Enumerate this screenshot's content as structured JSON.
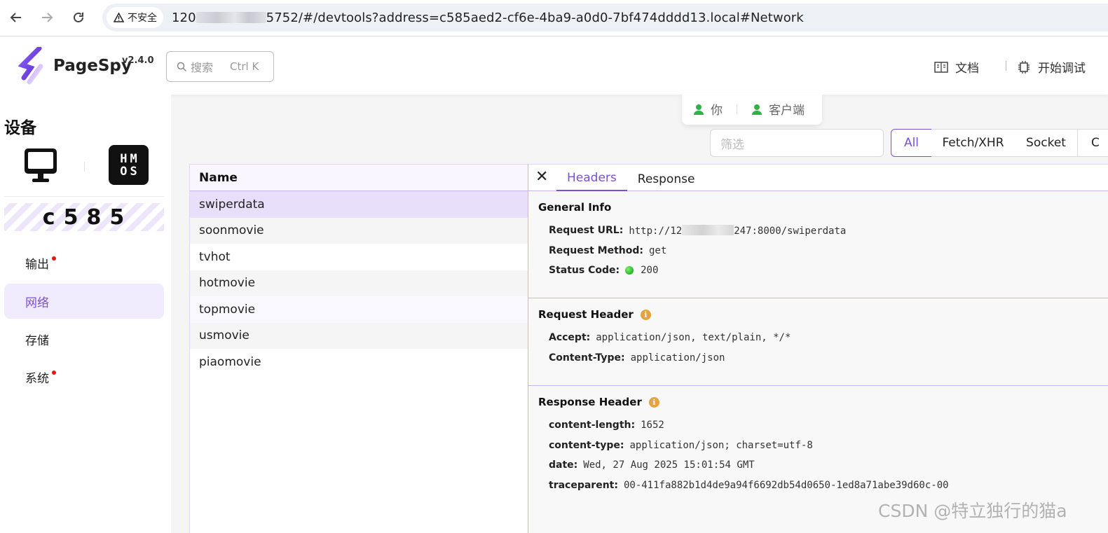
{
  "browser": {
    "security_label": "不安全",
    "url_prefix": "120",
    "url_suffix": "5752/#/devtools?address=c585aed2-cf6e-4ba9-a0d0-7bf474dddd13.local#Network"
  },
  "header": {
    "brand": "PageSpy",
    "version": "v2.4.0",
    "search_placeholder": "搜索",
    "search_shortcut": "Ctrl K",
    "docs_label": "文档",
    "start_debug_label": "开始调试"
  },
  "sidebar": {
    "title": "设备",
    "device_id": "c585",
    "hmos_text": [
      "HM",
      "OS"
    ],
    "items": [
      {
        "label": "输出",
        "has_dot": true
      },
      {
        "label": "网络",
        "has_dot": false,
        "active": true
      },
      {
        "label": "存储",
        "has_dot": false
      },
      {
        "label": "系统",
        "has_dot": true
      }
    ]
  },
  "roles": {
    "you": "你",
    "client": "客户端"
  },
  "filter": {
    "placeholder": "筛选",
    "types": [
      "All",
      "Fetch/XHR",
      "Socket",
      "C"
    ],
    "active_type": "All"
  },
  "network_list": {
    "header": "Name",
    "rows": [
      "swiperdata",
      "soonmovie",
      "tvhot",
      "hotmovie",
      "topmovie",
      "usmovie",
      "piaomovie"
    ],
    "selected": "swiperdata"
  },
  "detail": {
    "tabs": [
      "Headers",
      "Response"
    ],
    "active_tab": "Headers",
    "general": {
      "title": "General Info",
      "request_url_label": "Request URL:",
      "request_url_prefix": "http://12",
      "request_url_suffix": "247:8000/swiperdata",
      "request_method_label": "Request Method:",
      "request_method": "get",
      "status_code_label": "Status Code:",
      "status_code": "200"
    },
    "request_header": {
      "title": "Request Header",
      "items": [
        {
          "key": "Accept:",
          "value": "application/json, text/plain, */*"
        },
        {
          "key": "Content-Type:",
          "value": "application/json"
        }
      ]
    },
    "response_header": {
      "title": "Response Header",
      "items": [
        {
          "key": "content-length:",
          "value": "1652"
        },
        {
          "key": "content-type:",
          "value": "application/json; charset=utf-8"
        },
        {
          "key": "date:",
          "value": "Wed, 27 Aug 2025 15:01:54 GMT"
        },
        {
          "key": "traceparent:",
          "value": "00-411fa882b1d4de9a94f6692db54d0650-1ed8a71abe39d60c-00"
        }
      ]
    }
  },
  "watermark": "CSDN @特立独行的猫a",
  "colors": {
    "accent": "#7b4fd6",
    "status_ok": "#1db81a",
    "warning": "#e6a23c",
    "alert_dot": "#e6140c"
  }
}
